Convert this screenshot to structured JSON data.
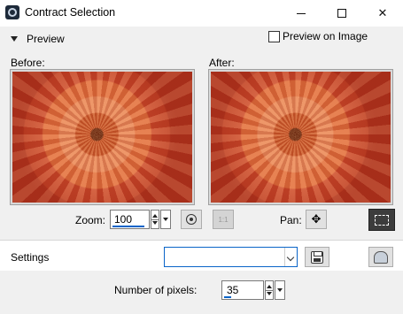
{
  "window": {
    "title": "Contract Selection",
    "app_icon": "paintshop-icon",
    "controls": [
      "minimize-icon",
      "maximize-icon",
      "close-icon"
    ]
  },
  "preview": {
    "toggle_label": "Preview",
    "expanded": true,
    "preview_on_image_label": "Preview on Image",
    "preview_on_image_checked": false
  },
  "panes": {
    "before_label": "Before:",
    "after_label": "After:"
  },
  "zoom": {
    "label": "Zoom:",
    "value": "100"
  },
  "pan": {
    "label": "Pan:"
  },
  "settings": {
    "label": "Settings",
    "preset_value": ""
  },
  "contract": {
    "pixels_label": "Number of pixels:",
    "pixels_value": "35"
  },
  "colors": {
    "accent": "#0a64c8",
    "active_button": "#3c3c3c"
  }
}
